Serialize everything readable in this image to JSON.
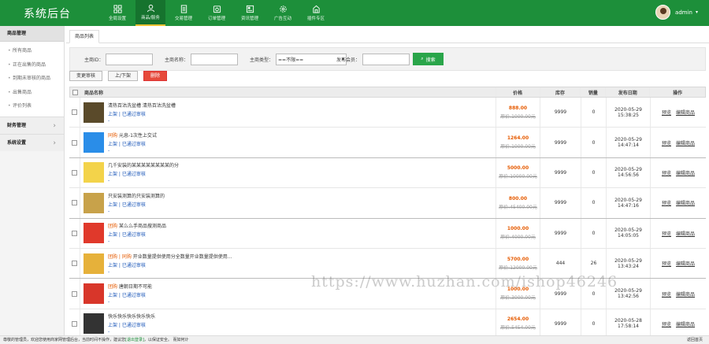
{
  "app": {
    "title": "系统后台"
  },
  "nav": [
    {
      "label": "全局设置",
      "icon": "grid-icon"
    },
    {
      "label": "商品/服务",
      "icon": "user-icon",
      "active": true
    },
    {
      "label": "交易管理",
      "icon": "document-icon"
    },
    {
      "label": "订单管理",
      "icon": "order-icon"
    },
    {
      "label": "资讯管理",
      "icon": "news-icon"
    },
    {
      "label": "广告互动",
      "icon": "gear-icon"
    },
    {
      "label": "插件专区",
      "icon": "plugin-icon"
    }
  ],
  "user": {
    "name": "admin"
  },
  "sidebar": {
    "header": "商品管理",
    "items": [
      "所有商品",
      "正在出售的商品",
      "到期未审核的商品",
      "出售商品",
      "评价列表"
    ],
    "groups": [
      "财务管理",
      "系统设置"
    ]
  },
  "tab": {
    "label": "商品列表"
  },
  "filter": {
    "id_label": "主商ID：",
    "name_label": "主商名称：",
    "type_label": "主商类型：",
    "type_value": "==不限==",
    "member_label": "发布会员：",
    "search_label": "搜索"
  },
  "actions": {
    "change_review": "变更审核",
    "shelf": "上/下架",
    "delete": "删除"
  },
  "table": {
    "headers": {
      "name": "商品名称",
      "price": "价格",
      "stock": "库存",
      "sales": "销量",
      "time": "发布日期",
      "op": "操作"
    },
    "rows": [
      {
        "thumb": "#5a4a2a",
        "tag": "",
        "title": "清热百沽洗盆槽 清热百沽洗盆槽",
        "links": "上架 | 已通过审核",
        "price": "888.00",
        "oprice": "原价:1000.00元",
        "stock": "9999",
        "sales": "0",
        "date": "2020-05-29",
        "time": "15:38:25",
        "op1": "预览",
        "op2": "编辑商品"
      },
      {
        "thumb": "#2a8de8",
        "tag": "同购",
        "title": "元息-1次性上交试",
        "links": "上架 | 已通过审核",
        "price": "1264.00",
        "oprice": "原价:1000.00元",
        "stock": "9999",
        "sales": "0",
        "date": "2020-05-29",
        "time": "14:47:14",
        "op1": "预览",
        "op2": "编辑商品"
      },
      {
        "thumb": "#f3d34a",
        "tag": "",
        "title": "几千安装的某某某某某某某某的分",
        "links": "上架 | 已通过审核",
        "price": "5000.00",
        "oprice": "原价:10000.00元",
        "stock": "9999",
        "sales": "0",
        "date": "2020-05-29",
        "time": "14:56:56",
        "op1": "预览",
        "op2": "编辑商品"
      },
      {
        "thumb": "#c8a24a",
        "tag": "",
        "title": "只安装测算的只安装测算的",
        "links": "上架 | 已通过审核",
        "price": "800.00",
        "oprice": "原价:45400.00元",
        "stock": "9999",
        "sales": "0",
        "date": "2020-05-29",
        "time": "14:47:16",
        "op1": "预览",
        "op2": "编辑商品"
      },
      {
        "thumb": "#e0392b",
        "tag": "团购",
        "title": "某么么手商品搜测商品",
        "links": "上架 | 已通过审核",
        "price": "1000.00",
        "oprice": "原价:4000.00元",
        "stock": "9999",
        "sales": "0",
        "date": "2020-05-29",
        "time": "14:05:05",
        "op1": "预览",
        "op2": "编辑商品"
      },
      {
        "thumb": "#e6b13a",
        "tag": "团购 | 同购",
        "title": "开业数量提供使用分全数量开业数量提供使用...",
        "links": "上架 | 已通过审核",
        "price": "5700.00",
        "oprice": "原价:12000.00元",
        "stock": "444",
        "sales": "26",
        "date": "2020-05-29",
        "time": "13:43:24",
        "op1": "预览",
        "op2": "编辑商品"
      },
      {
        "thumb": "#d8362a",
        "tag": "团购",
        "title": "唐朝日期不可能",
        "links": "上架 | 已通过审核",
        "price": "1000.00",
        "oprice": "原价:3000.00元",
        "stock": "9999",
        "sales": "0",
        "date": "2020-05-29",
        "time": "13:42:56",
        "op1": "预览",
        "op2": "编辑商品"
      },
      {
        "thumb": "#333333",
        "tag": "",
        "title": "快乐快乐快乐快乐快乐",
        "links": "上架 | 已通过审核",
        "price": "2654.00",
        "oprice": "原价:5454.00元",
        "stock": "9999",
        "sales": "0",
        "date": "2020-05-28",
        "time": "17:58:14",
        "op1": "预览",
        "op2": "编辑商品"
      }
    ]
  },
  "status": {
    "text_before": "尊敬的管理员，欢迎您使用商家网管理后台，当前时间不操作，建议您",
    "link": "[退出登录]",
    "text_after": "，以保证安全。 而如何计",
    "right": "返回首页"
  },
  "watermark": "https://www.huzhan.com/ishop46246"
}
